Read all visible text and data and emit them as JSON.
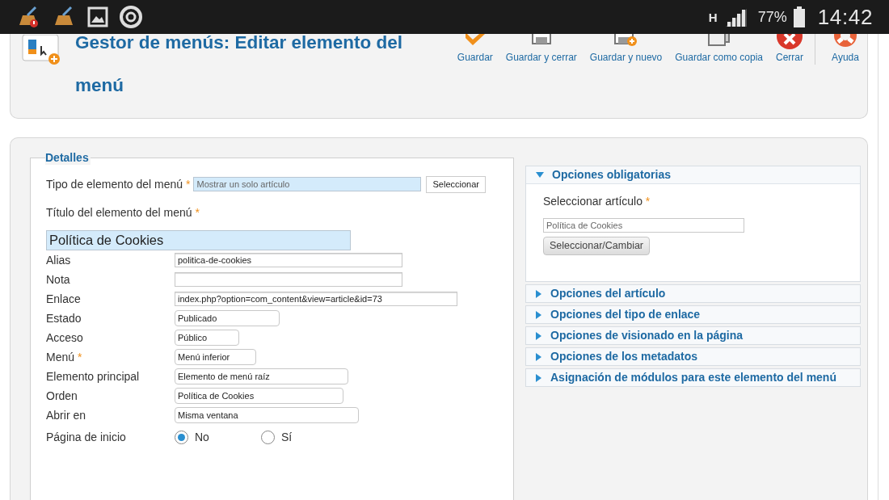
{
  "status_bar": {
    "network": "H",
    "battery": "77%",
    "time": "14:42"
  },
  "header": {
    "title": "Gestor de menús: Editar elemento del menú",
    "toolbar": [
      {
        "kind": "save",
        "label": "Guardar"
      },
      {
        "kind": "save_close",
        "label": "Guardar y cerrar"
      },
      {
        "kind": "save_new",
        "label": "Guardar y nuevo"
      },
      {
        "kind": "save_copy",
        "label": "Guardar como copia"
      },
      {
        "kind": "close",
        "label": "Cerrar"
      },
      {
        "kind": "help",
        "label": "Ayuda"
      }
    ]
  },
  "details": {
    "legend": "Detalles",
    "fields": [
      {
        "kind": "type",
        "label": "Tipo de elemento del menú",
        "marker": "*",
        "value": "Mostrar un solo artículo",
        "button": "Seleccionar"
      },
      {
        "kind": "title",
        "label": "Título del elemento del menú",
        "marker": "*",
        "value": "Política de Cookies"
      },
      {
        "kind": "text",
        "label": "Alias",
        "value": "politica-de-cookies"
      },
      {
        "kind": "text",
        "label": "Nota"
      },
      {
        "kind": "text",
        "label": "Enlace",
        "value": "index.php?option=com_content&view=article&id=73"
      },
      {
        "kind": "select",
        "label": "Estado",
        "value": "Publicado"
      },
      {
        "kind": "select",
        "label": "Acceso",
        "value": "Público"
      },
      {
        "kind": "select",
        "label": "Menú",
        "marker": "*",
        "value": "Menú inferior"
      },
      {
        "kind": "select",
        "label": "Elemento principal",
        "value": "Elemento de menú raíz"
      },
      {
        "kind": "select",
        "label": "Orden",
        "value": "Política de Cookies"
      },
      {
        "kind": "select",
        "label": "Abrir en",
        "value": "Misma ventana"
      },
      {
        "kind": "radio",
        "label": "Página de inicio",
        "options": [
          {
            "label": "No",
            "selected": true
          },
          {
            "label": "Sí",
            "selected": false
          }
        ]
      }
    ]
  },
  "panels": [
    {
      "title": "Opciones obligatorias",
      "expanded": true,
      "field_label": "Seleccionar artículo",
      "marker": "*",
      "value": "Política de Cookies",
      "button": "Seleccionar/Cambiar"
    },
    {
      "title": "Opciones del artículo",
      "expanded": false
    },
    {
      "title": "Opciones del tipo de enlace",
      "expanded": false
    },
    {
      "title": "Opciones de visionado en la página",
      "expanded": false
    },
    {
      "title": "Opciones de los metadatos",
      "expanded": false
    },
    {
      "title": "Asignación de módulos para este elemento del menú",
      "expanded": false
    }
  ]
}
